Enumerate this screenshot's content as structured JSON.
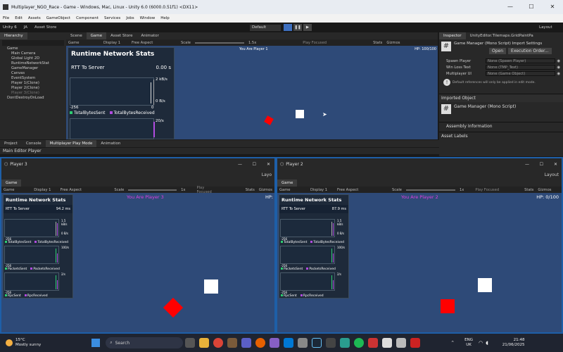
{
  "window": {
    "title": "Multiplayer_NGO_Race - Game - Windows, Mac, Linux - Unity 6.0 (6000.0.51f1) <DX11>",
    "min": "—",
    "max": "☐",
    "close": "✕"
  },
  "menu": [
    "File",
    "Edit",
    "Assets",
    "GameObject",
    "Component",
    "Services",
    "Jobs",
    "Window",
    "Help"
  ],
  "toolbar": {
    "unity": "Unity 6",
    "account": "JA",
    "asset_store": "Asset Store",
    "layout_mode": "Default",
    "layout": "Layout"
  },
  "hierarchy": {
    "tab": "Hierarchy",
    "items": [
      "Game",
      "Main Camera",
      "Global Light 2D",
      "RuntimeNetworkStat",
      "GameManager",
      "Canvas",
      "EventSystem",
      "Player 1(Clone)",
      "Player 2(Clone)",
      "Player 3(Clone)",
      "DontDestroyOnLoad"
    ]
  },
  "center_tabs": [
    "Scene",
    "Game",
    "Asset Store",
    "Animator"
  ],
  "game_bar": {
    "display": "Display 1",
    "aspect": "Free Aspect",
    "scale_label": "Scale",
    "scale_value": "1.5x",
    "play_focused": "Play Focused",
    "stats": "Stats",
    "gizmos": "Gizmos"
  },
  "main_game": {
    "player_text": "You Are Player 1",
    "hp": "HP: 100/100"
  },
  "net_stats": {
    "title": "Runtime Network Stats",
    "rtt_label": "RTT To Server",
    "rtt_value": "0.00 s",
    "y_top": "2 kB/s",
    "y_bottom": "0 B/s",
    "x_left": "-256",
    "x_right": "0",
    "legend1": "TotalBytesSent",
    "legend2": "TotalBytesReceived",
    "second_top": "20/s"
  },
  "inspector": {
    "tabs": [
      "Inspector",
      "UnityEditor.Tilemaps.GridPaintPa"
    ],
    "component": "Game Manager (Mono Script) Import Settings",
    "open": "Open",
    "execution_order": "Execution Order...",
    "fields": [
      {
        "label": "Spawn Player",
        "value": "None (Spawn Player)"
      },
      {
        "label": "Win Loss Text",
        "value": "None (TMP_Text)"
      },
      {
        "label": "Multiplayer UI",
        "value": "None (Game Object)"
      }
    ],
    "note": "Default references will only be applied in edit mode.",
    "imported": "Imported Object",
    "imported_name": "Game Manager (Mono Script)",
    "assembly": "Assembly Information",
    "asset_labels": "Asset Labels"
  },
  "bottom_tabs": [
    "Project",
    "Console",
    "Multiplayer Play Mode",
    "Animation"
  ],
  "main_editor": "Main Editor Player",
  "player3": {
    "title": "Player 3",
    "tab": "Game",
    "player_text": "You Are Player 3",
    "hp": "HP:",
    "rtt": "94.2 ms",
    "g1top": "1.5 kB/s",
    "g1bot": "0 B/s",
    "l1a": "TotalBytesSent",
    "l1b": "TotalBytesReceived",
    "g2top": "100/s",
    "l2a": "PacketsSent",
    "l2b": "PacketsReceived",
    "g3top": "2/s",
    "l3a": "RpcSent",
    "l3b": "RpcReceived",
    "scale_value": "1x",
    "layout": "Layo"
  },
  "player2": {
    "title": "Player 2",
    "tab": "Game",
    "player_text": "You Are Player 2",
    "hp": "HP: 0/100",
    "rtt": "87.9 ms",
    "g1top": "1.5 kB/s",
    "g1bot": "0 B/s",
    "l1a": "TotalBytesSent",
    "l1b": "TotalBytesReceived",
    "g2top": "100/s",
    "l2a": "PacketsSent",
    "l2b": "PacketsReceived",
    "g3top": "2/s",
    "l3a": "RpcSent",
    "l3b": "RpcReceived",
    "scale_value": "1x",
    "layout": "Layout"
  },
  "taskbar": {
    "temp": "15°C",
    "weather": "Mostly sunny",
    "search": "Search",
    "lang": "ENG",
    "region": "UK",
    "time": "21:48",
    "date": "21/06/2025"
  },
  "colors": {
    "game_bg": "#2e4a78",
    "accent": "#1e5fa8",
    "red": "#ff0000"
  }
}
